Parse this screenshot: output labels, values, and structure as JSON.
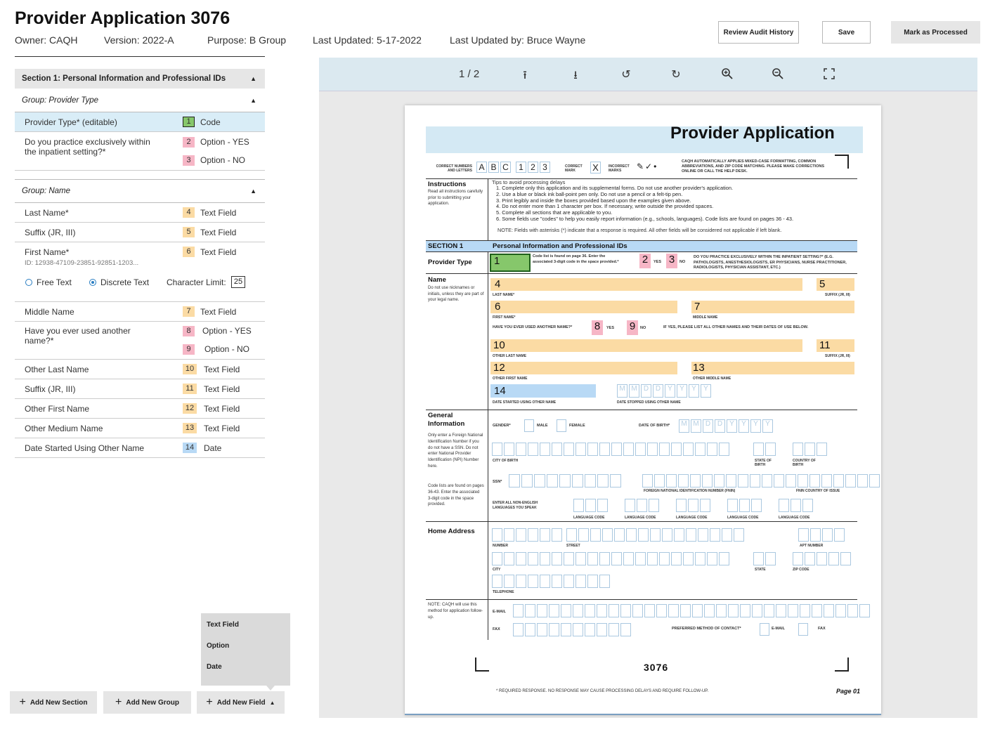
{
  "header": {
    "title": "Provider Application 3076",
    "owner": "Owner: CAQH",
    "version": "Version: 2022-A",
    "purpose": "Purpose: B Group",
    "last_updated": "Last Updated: 5-17-2022",
    "last_updated_by": "Last Updated by: Bruce Wayne",
    "review_audit_label": "Review Audit History",
    "save_label": "Save",
    "mark_processed_label": "Mark as Processed"
  },
  "left_panel": {
    "section_title": "Section 1: Personal Information and Professional IDs",
    "group_provider_type": "Group: Provider Type",
    "group_name": "Group: Name",
    "rows": [
      {
        "label": "Provider Type* (editable)",
        "num": "1",
        "type": "Code"
      },
      {
        "label": "Do you practice exclusively within the inpatient setting?*",
        "num": "2",
        "type": "Option - YES",
        "num2": "3",
        "type2": "Option - NO"
      },
      {
        "label": "Last Name*",
        "num": "4",
        "type": "Text Field"
      },
      {
        "label": "Suffix (JR, III)",
        "num": "5",
        "type": "Text Field"
      },
      {
        "label": "First Name*",
        "num": "6",
        "type": "Text Field",
        "id": "ID: 12938-47109-23851-92851-1203..."
      },
      {
        "label": "Middle Name",
        "num": "7",
        "type": "Text Field"
      },
      {
        "label": "Have you ever used another name?*",
        "num": "8",
        "type": "Option - YES",
        "num2": "9",
        "type2": "Option - NO"
      },
      {
        "label": "Other Last Name",
        "num": "10",
        "type": "Text Field"
      },
      {
        "label": "Suffix (JR, III)",
        "num": "11",
        "type": "Text Field"
      },
      {
        "label": "Other First Name",
        "num": "12",
        "type": "Text Field"
      },
      {
        "label": "Other Medium Name",
        "num": "13",
        "type": "Text Field"
      },
      {
        "label": "Date Started Using Other Name",
        "num": "14",
        "type": "Date"
      }
    ],
    "free_text": "Free Text",
    "discrete_text": "Discrete Text",
    "char_limit_label": "Character Limit:",
    "char_limit_value": "25"
  },
  "bottom": {
    "add_section": "Add New Section",
    "add_group": "Add New Group",
    "add_field": "Add New Field",
    "dropdown": [
      "Text Field",
      "Option",
      "Date"
    ]
  },
  "viewer": {
    "page_indicator": "1 / 2",
    "tools": [
      "upload-icon",
      "download-icon",
      "rotate-left-icon",
      "rotate-right-icon",
      "zoom-in-icon",
      "zoom-out-icon",
      "fullscreen-icon"
    ]
  },
  "form": {
    "title": "Provider Application",
    "correct_numbers": "CORRECT NUMBERS AND LETTERS",
    "letters": [
      "A",
      "B",
      "C",
      "1",
      "2",
      "3"
    ],
    "correct_mark": "CORRECT MARK",
    "incorrect_marks": "INCORRECT MARKS",
    "caqh_note": "CAQH AUTOMATICALLY APPLIES MIXED-CASE FORMATTING, COMMON ABBREVIATIONS, AND ZIP CODE MATCHING. PLEASE MAKE CORRECTIONS ONLINE OR CALL THE HELP DESK.",
    "instructions_title": "Instructions",
    "instructions_text": "Read all instructions carefully prior to submitting your application.",
    "tips_title": "Tips to avoid processing delays",
    "tips": [
      "1. Complete only this application and its supplemental forms. Do not use another provider's application.",
      "2. Use a blue or black ink ball-point pen only. Do not use a pencil or a felt-tip pen.",
      "3. Print legibly and inside the boxes provided based upon the examples given above.",
      "4. Do not enter more than 1 character per box. If necessary, write outside the provided spaces.",
      "5. Complete all sections that are applicable to you.",
      "6. Some fields use \"codes\" to help you easily report information (e.g., schools, languages). Code lists are found on pages 36 - 43."
    ],
    "note": "NOTE: Fields with asterisks (*) indicate that a response is required. All other fields will be considered not applicable if left blank.",
    "section_label": "SECTION 1",
    "section_title": "Personal Information and Professional IDs",
    "provider_type": "Provider Type",
    "code_note": "Code list is found on page 36. Enter the associated 3-digit code in the space provided.*",
    "yes": "YES",
    "no": "NO",
    "inpatient_q": "DO YOU PRACTICE EXCLUSIVELY WITHIN THE INPATIENT SETTING?* (E.G. PATHOLOGISTS, ANESTHESIOLOGISTS, ER PHYSICIANS, NURSE PRACTITIONER, RADIOLOGISTS, PHYSICIAN ASSISTANT, ETC.)",
    "name_title": "Name",
    "name_note": "Do not use nicknames or initials, unless they are part of your legal name.",
    "last_name": "LAST NAME*",
    "suffix": "SUFFIX (JR, III)",
    "first_name": "FIRST NAME*",
    "middle_name": "MIDDLE NAME",
    "other_name_q": "HAVE YOU EVER USED ANOTHER NAME?*",
    "other_name_list": "IF YES, PLEASE LIST ALL OTHER NAMES AND THEIR DATES OF USE BELOW.",
    "other_last": "OTHER LAST NAME",
    "other_first": "OTHER FIRST NAME",
    "other_middle": "OTHER MIDDLE NAME",
    "date_started": "DATE STARTED USING OTHER NAME",
    "date_stopped": "DATE STOPPED USING OTHER NAME",
    "general_title": "General Information",
    "general_note": "Only enter a Foreign National Identification Number if you do not have a SSN. Do not enter National Provider Identification (NPI) Number here.",
    "code_lists_note": "Code lists are found on pages 36-43. Enter the associated 3-digit code in the space provided.",
    "gender": "GENDER*",
    "male": "MALE",
    "female": "FEMALE",
    "dob": "DATE OF BIRTH*",
    "city_birth": "CITY OF BIRTH",
    "state_birth": "STATE OF BIRTH",
    "country_birth": "COUNTRY OF BIRTH",
    "ssn": "SSN*",
    "fnin": "FOREIGN NATIONAL IDENTIFICATION NUMBER (FNIN)",
    "fnin_country": "FNIN COUNTRY OF ISSUE",
    "languages": "ENTER ALL NON-ENGLISH LANGUAGES YOU SPEAK",
    "language_code": "LANGUAGE CODE",
    "home_title": "Home Address",
    "number": "NUMBER",
    "street": "STREET",
    "apt": "APT NUMBER",
    "city": "CITY",
    "state": "STATE",
    "zip": "ZIP CODE",
    "telephone": "TELEPHONE",
    "caqh_contact_note": "NOTE: CAQH will use this method for application follow-up.",
    "email": "E-MAIL",
    "fax": "FAX",
    "preferred_method": "PREFERRED METHOD OF CONTACT*",
    "form_number": "3076",
    "footer_note": "* REQUIRED RESPONSE. NO RESPONSE MAY CAUSE PROCESSING DELAYS AND REQUIRE FOLLOW-UP.",
    "page_label": "Page 01",
    "date_chars": [
      "M",
      "M",
      "D",
      "D",
      "Y",
      "Y",
      "Y",
      "Y"
    ],
    "marks": [
      "1",
      "2",
      "3",
      "4",
      "5",
      "6",
      "7",
      "8",
      "9",
      "10",
      "11",
      "12",
      "13",
      "14"
    ]
  },
  "colors": {
    "code": "#86c76b",
    "option": "#f6b6c6",
    "text": "#fbdba4",
    "date": "#b8d9f5",
    "highlight": "#d9edf7"
  }
}
